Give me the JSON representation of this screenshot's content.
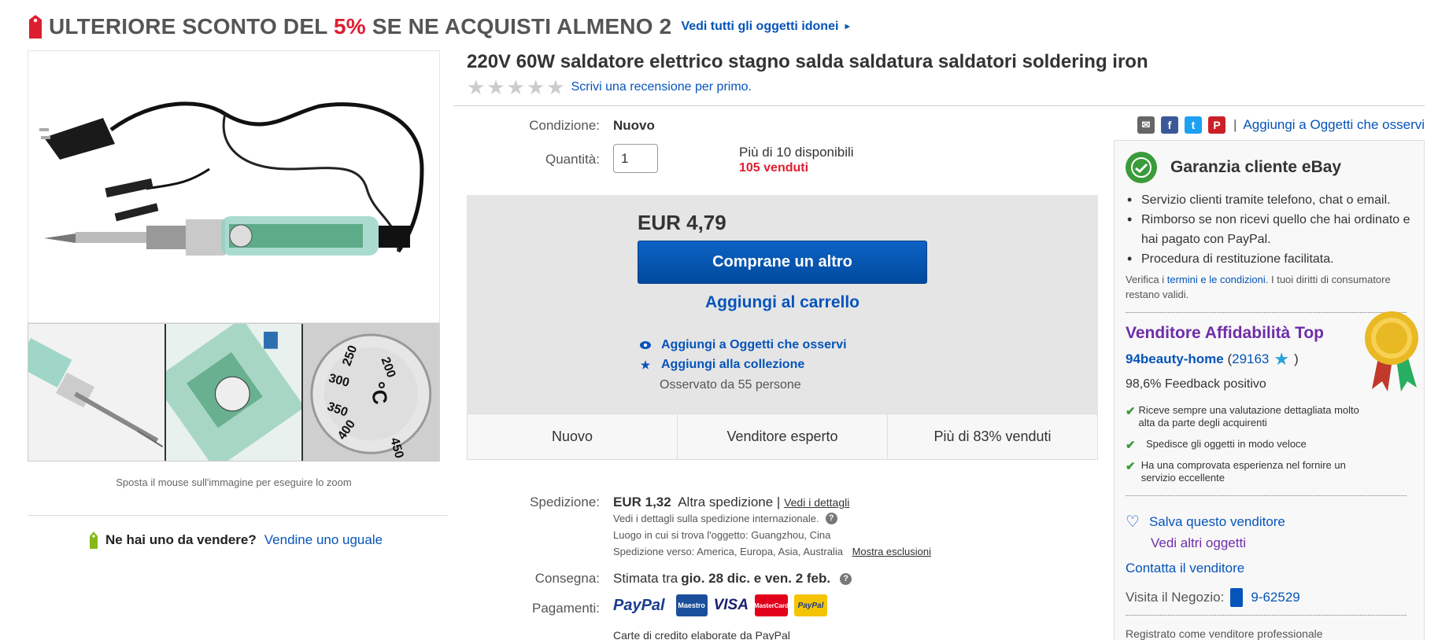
{
  "promo": {
    "prefix": "ULTERIORE SCONTO DEL ",
    "percent": "5%",
    "suffix": " SE NE ACQUISTI ALMENO 2",
    "link": "Vedi tutti gli oggetti idonei"
  },
  "gallery": {
    "zoom_hint": "Sposta il mouse sull'immagine per eseguire lo zoom",
    "dial_labels": [
      "200",
      "250",
      "300",
      "350",
      "400",
      "450",
      "°C"
    ]
  },
  "sell": {
    "question": "Ne hai uno da vendere?",
    "link": "Vendine uno uguale"
  },
  "item": {
    "title": "220V 60W saldatore elettrico stagno salda saldatura saldatori soldering iron",
    "review_link": "Scrivi una recensione per primo.",
    "rating": 0
  },
  "details": {
    "condition_label": "Condizione:",
    "condition_value": "Nuovo",
    "quantity_label": "Quantità:",
    "quantity_value": "1",
    "available": "Più di 10 disponibili",
    "sold": "105 venduti"
  },
  "buy": {
    "price": "EUR 4,79",
    "buy_button": "Comprane un altro",
    "cart_button": "Aggiungi al carrello",
    "watch_link": "Aggiungi a Oggetti che osservi",
    "collection_link": "Aggiungi alla collezione",
    "watchers": "Osservato da 55 persone"
  },
  "badges": [
    "Nuovo",
    "Venditore esperto",
    "Più di 83% venduti"
  ],
  "shipping": {
    "label": "Spedizione:",
    "price": "EUR 1,32",
    "method": "Altra spedizione |",
    "details_link": "Vedi i dettagli",
    "intl_note": "Vedi i dettagli sulla spedizione internazionale.",
    "location": "Luogo in cui si trova l'oggetto:  Guangzhou, Cina",
    "ships_to": "Spedizione verso:  America, Europa, Asia, Australia",
    "exclusions_link": "Mostra esclusioni"
  },
  "delivery": {
    "label": "Consegna:",
    "prefix": "Stimata tra",
    "dates": "gio. 28 dic. e ven. 2 feb."
  },
  "payments": {
    "label": "Pagamenti:",
    "paypal": "PayPal",
    "maestro": "Maestro",
    "visa": "VISA",
    "mastercard": "MasterCard",
    "paypal_credit": "PayPal",
    "note": "Carte di credito elaborate da PayPal"
  },
  "share": {
    "pipe": "|",
    "watch_link": "Aggiungi a Oggetti che osservi"
  },
  "guarantee": {
    "title": "Garanzia cliente eBay",
    "items": [
      "Servizio clienti tramite telefono, chat o email.",
      "Rimborso se non ricevi quello che hai ordinato e hai pagato con PayPal.",
      "Procedura di restituzione facilitata."
    ],
    "verify_prefix": "Verifica i ",
    "verify_link": "termini e le condizioni",
    "verify_suffix": ". I tuoi diritti di consumatore restano validi."
  },
  "seller": {
    "top_rated": "Venditore Affidabilità Top",
    "name": "94beauty-home",
    "score_open": "(",
    "score": "29163",
    "score_close": ")",
    "feedback": "98,6% Feedback positivo",
    "checks": [
      "Riceve sempre una valutazione dettagliata molto alta da parte degli acquirenti",
      "Spedisce gli oggetti in modo veloce",
      "Ha una comprovata esperienza nel fornire un servizio eccellente"
    ],
    "save_link": "Salva questo venditore",
    "other_items": "Vedi altri oggetti",
    "contact": "Contatta il venditore",
    "visit_label": "Visita il Negozio:",
    "shop_name": "9-62529",
    "registered": "Registrato come venditore professionale"
  },
  "colors": {
    "link": "#0654ba",
    "price_red": "#dd1e31",
    "top_rated_purple": "#6f2da8",
    "check_green": "#3a9b3a",
    "buy_button": "#0d63c4"
  }
}
